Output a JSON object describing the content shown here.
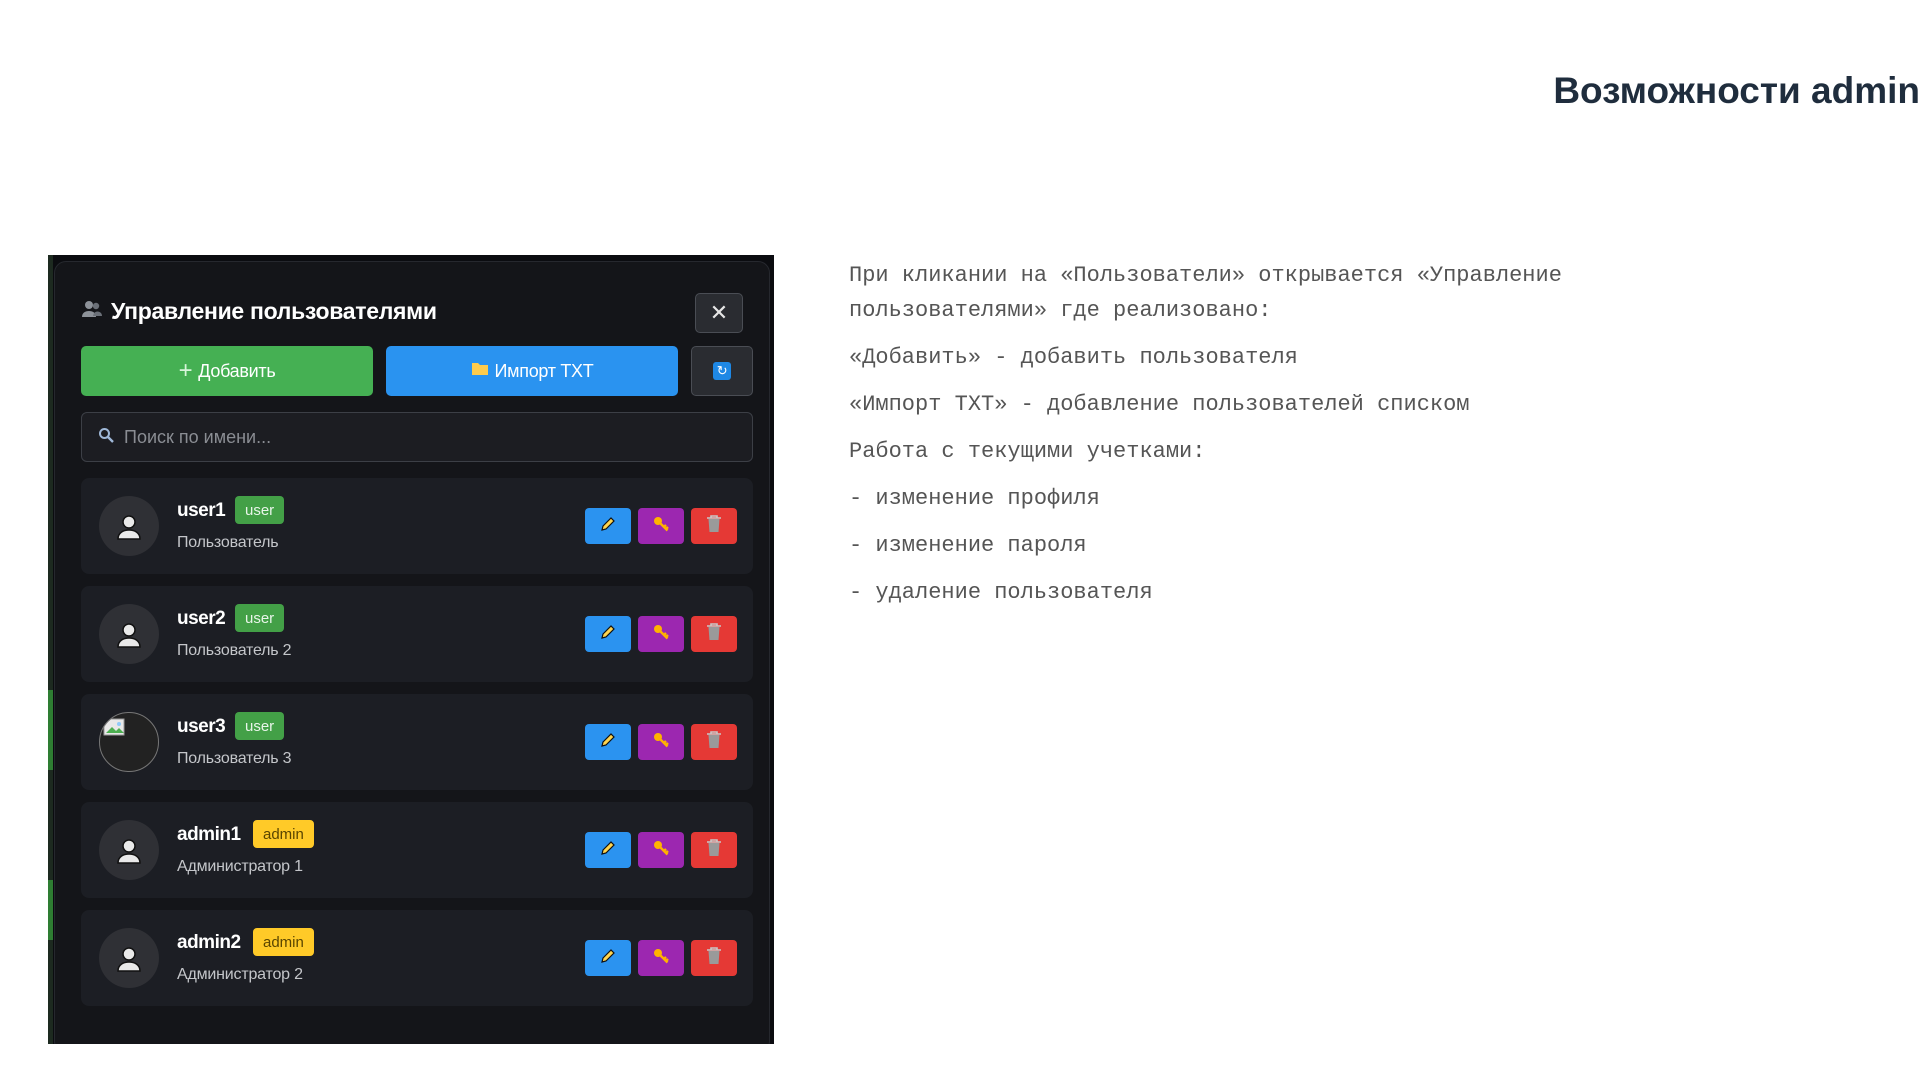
{
  "slide": {
    "title": "Возможности admin"
  },
  "modal": {
    "title": "Управление пользователями",
    "header_icon": "users-icon",
    "close_label": "✕",
    "add_label": "Добавить",
    "import_label": "Импорт TXT",
    "refresh_icon": "refresh-icon",
    "search_placeholder": "Поиск по имени..."
  },
  "users": [
    {
      "username": "user1",
      "role": "user",
      "full_name": "Пользователь",
      "avatar": "default"
    },
    {
      "username": "user2",
      "role": "user",
      "full_name": "Пользователь 2",
      "avatar": "default"
    },
    {
      "username": "user3",
      "role": "user",
      "full_name": "Пользователь 3",
      "avatar": "broken-image"
    },
    {
      "username": "admin1",
      "role": "admin",
      "full_name": "Администратор 1",
      "avatar": "default"
    },
    {
      "username": "admin2",
      "role": "admin",
      "full_name": "Администратор 2",
      "avatar": "default"
    }
  ],
  "description": {
    "intro": "При кликании на «Пользователи» открывается «Управление пользователями» где реализовано:",
    "add": "«Добавить» - добавить пользователя",
    "import": "«Импорт TXT» - добавление пользователей списком",
    "work": "Работа с текущими учетками:",
    "items": [
      " - изменение профиля",
      " - изменение пароля",
      " - удаление пользователя"
    ]
  },
  "colors": {
    "add_button": "#45b053",
    "import_button": "#2a93f0",
    "edit_button": "#2b93f0",
    "password_button": "#9c27b0",
    "delete_button": "#e53935",
    "badge_user": "#43a047",
    "badge_admin": "#ffca28"
  }
}
